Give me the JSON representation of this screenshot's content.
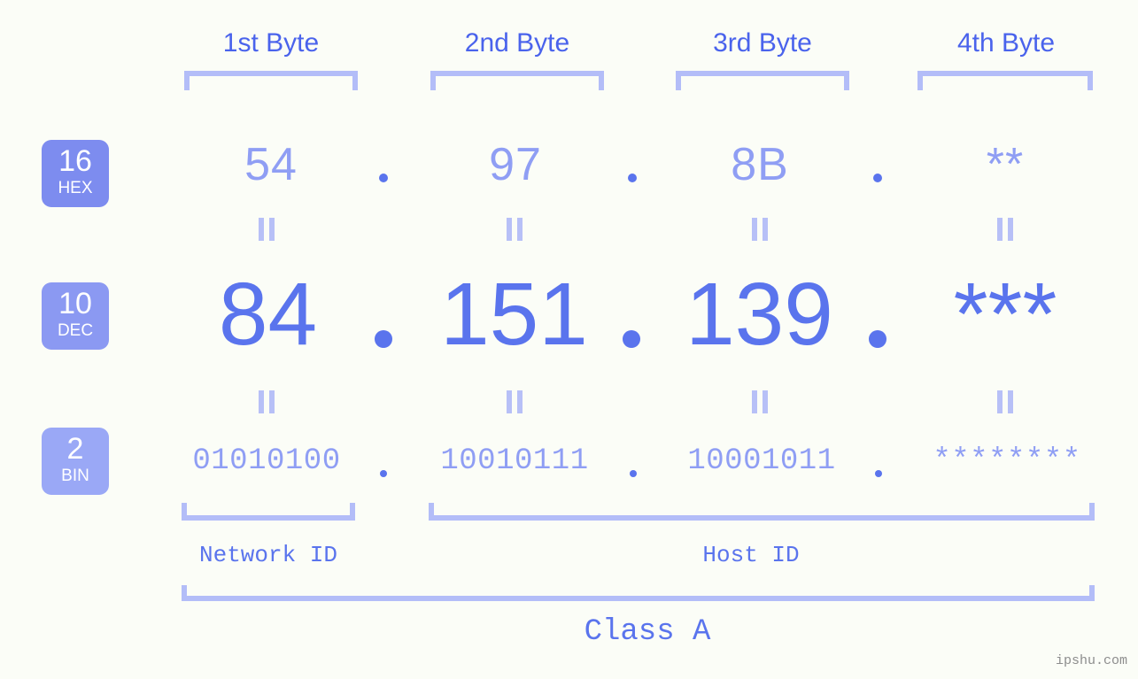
{
  "page": {
    "background_color": "#fbfdf7",
    "watermark": "ipshu.com"
  },
  "colors": {
    "header_blue": "#4a63ec",
    "bracket_blue": "#b3bdf8",
    "value_light": "#8f9ef4",
    "value_strong": "#5a74ed",
    "badge_hex": "#7d8cef",
    "badge_dec": "#8b99f2",
    "badge_bin": "#9aa8f6",
    "badge_text": "#ffffff",
    "watermark_gray": "#8d8d8d"
  },
  "byte_headers": [
    {
      "label": "1st Byte"
    },
    {
      "label": "2nd Byte"
    },
    {
      "label": "3rd Byte"
    },
    {
      "label": "4th Byte"
    }
  ],
  "bases": [
    {
      "number": "16",
      "system": "HEX"
    },
    {
      "number": "10",
      "system": "DEC"
    },
    {
      "number": "2",
      "system": "BIN"
    }
  ],
  "rows": {
    "hex": {
      "octets": [
        "54",
        "97",
        "8B",
        "**"
      ],
      "separator": "."
    },
    "dec": {
      "octets": [
        "84",
        "151",
        "139",
        "***"
      ],
      "separator": "."
    },
    "bin": {
      "octets": [
        "01010100",
        "10010111",
        "10001011",
        "********"
      ],
      "separator": "."
    }
  },
  "equality_symbol": "=",
  "segments": {
    "network_id": "Network ID",
    "host_id": "Host ID",
    "class": "Class A"
  }
}
